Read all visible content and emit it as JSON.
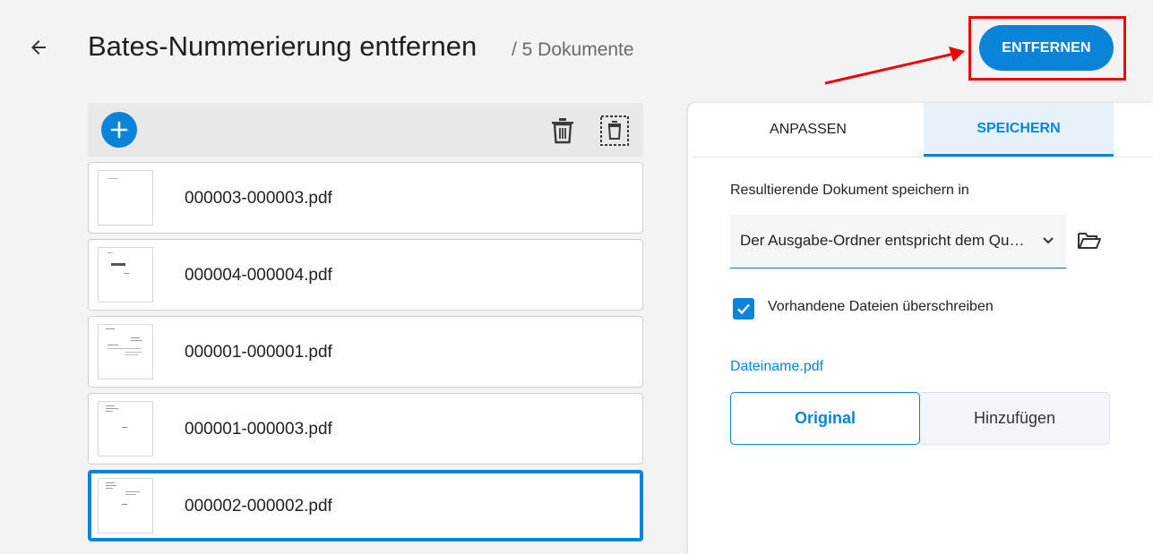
{
  "header": {
    "title": "Bates-Nummerierung entfernen",
    "subtitle": "/ 5 Dokumente",
    "primary_button": "ENTFERNEN",
    "accent_color": "#0a84d8",
    "highlight_color": "#ee0000"
  },
  "toolbar": {
    "add_icon": "plus-circle-icon",
    "delete_icon": "trash-icon",
    "delete_all_icon": "trash-dashed-icon"
  },
  "files": [
    {
      "name": "000003-000003.pdf",
      "selected": false
    },
    {
      "name": "000004-000004.pdf",
      "selected": false
    },
    {
      "name": "000001-000001.pdf",
      "selected": false
    },
    {
      "name": "000001-000003.pdf",
      "selected": false
    },
    {
      "name": "000002-000002.pdf",
      "selected": true
    }
  ],
  "panel": {
    "tabs": [
      {
        "label": "ANPASSEN",
        "active": false
      },
      {
        "label": "SPEICHERN",
        "active": true
      }
    ],
    "save_label": "Resultierende Dokument speichern in",
    "output_select": {
      "value": "Der Ausgabe-Ordner entspricht dem Quellordner"
    },
    "overwrite": {
      "label": "Vorhandene Dateien überschreiben",
      "checked": true
    },
    "filename_label": "Dateiname.pdf",
    "filename_options": [
      {
        "label": "Original",
        "selected": true
      },
      {
        "label": "Hinzufügen",
        "selected": false
      }
    ]
  }
}
